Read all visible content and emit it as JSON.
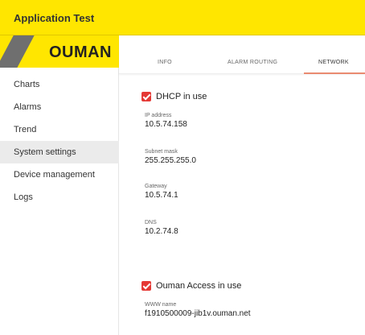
{
  "app": {
    "title": "Application Test"
  },
  "logo": {
    "text": "OUMAN"
  },
  "sidebar": {
    "items": [
      {
        "label": "Charts"
      },
      {
        "label": "Alarms"
      },
      {
        "label": "Trend"
      },
      {
        "label": "System settings"
      },
      {
        "label": "Device management"
      },
      {
        "label": "Logs"
      }
    ],
    "active": "System settings"
  },
  "tabs": [
    {
      "label": "INFO"
    },
    {
      "label": "ALARM ROUTING"
    },
    {
      "label": "NETWORK"
    }
  ],
  "active_tab": "NETWORK",
  "network": {
    "dhcp": {
      "label": "DHCP in use",
      "checked": true
    },
    "fields": [
      {
        "label": "IP address",
        "value": "10.5.74.158"
      },
      {
        "label": "Subnet mask",
        "value": "255.255.255.0"
      },
      {
        "label": "Gateway",
        "value": "10.5.74.1"
      },
      {
        "label": "DNS",
        "value": "10.2.74.8"
      }
    ],
    "ouman_access": {
      "label": "Ouman Access in use",
      "checked": true
    },
    "www_name": {
      "label": "WWW name",
      "value": "f1910500009-jib1v.ouman.net"
    }
  },
  "colors": {
    "brand_yellow": "#ffe600",
    "logo_gray": "#6f6f6f",
    "checkbox_red": "#e53935",
    "tab_underline": "#e98a70",
    "active_nav_bg": "#ebebeb"
  },
  "icons": {
    "checkbox": "checkbox-checked-icon"
  }
}
